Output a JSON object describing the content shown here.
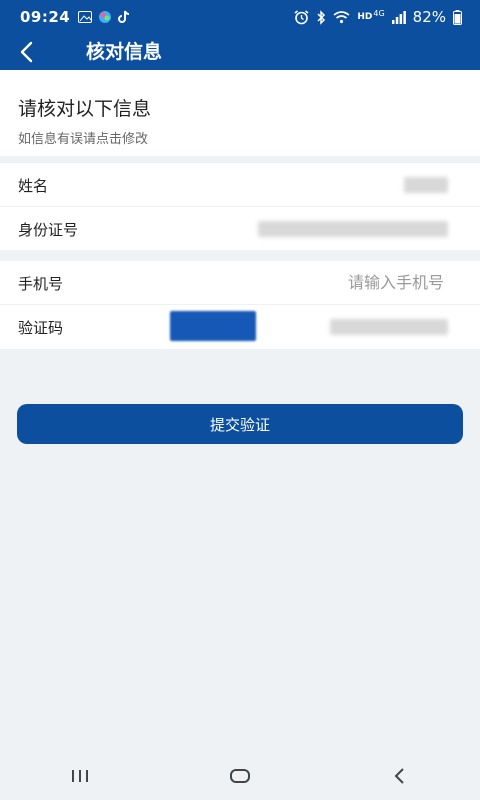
{
  "status_bar": {
    "time": "09:24",
    "battery_percent": "82%",
    "network_label": "HD",
    "signal_label": "4G",
    "left_icons": [
      "image-icon",
      "app-icon",
      "tiktok-icon"
    ],
    "right_icons": [
      "alarm-icon",
      "bluetooth-icon",
      "wifi-icon",
      "signal-icon",
      "battery-icon"
    ]
  },
  "header": {
    "title": "核对信息",
    "back_icon": "chevron-left-icon"
  },
  "intro": {
    "heading": "请核对以下信息",
    "subtitle": "如信息有误请点击修改"
  },
  "fields": {
    "name_label": "姓名",
    "id_label": "身份证号",
    "phone_label": "手机号",
    "phone_placeholder": "请输入手机号",
    "code_label": "验证码"
  },
  "submit": {
    "label": "提交验证"
  },
  "nav": {
    "recent_icon": "recent-apps-icon",
    "home_icon": "home-icon",
    "back_icon": "back-icon"
  },
  "colors": {
    "primary": "#0b4f9e",
    "background": "#eef2f4"
  }
}
